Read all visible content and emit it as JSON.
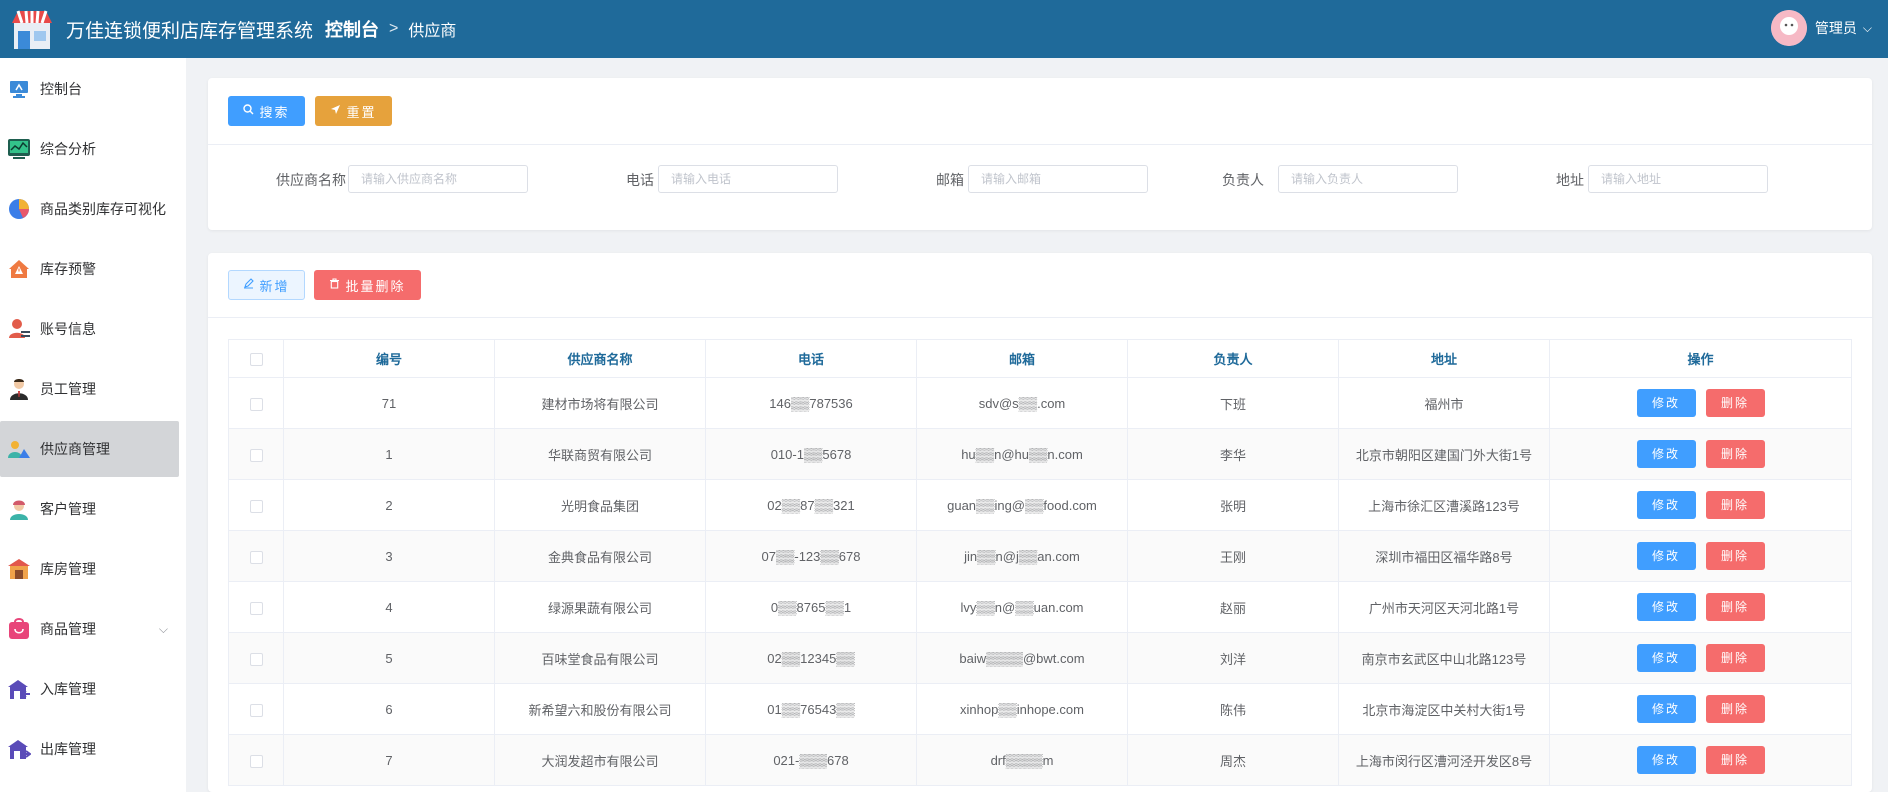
{
  "header": {
    "app_title": "万佳连锁便利店库存管理系统",
    "breadcrumb_home": "控制台",
    "breadcrumb_sep": ">",
    "breadcrumb_current": "供应商",
    "user_name": "管理员",
    "user_caret": "⌵"
  },
  "sidebar": {
    "items": [
      {
        "label": "控制台",
        "icon": "monitor-icon"
      },
      {
        "label": "综合分析",
        "icon": "analytics-icon"
      },
      {
        "label": "商品类别库存可视化",
        "icon": "pie-chart-icon"
      },
      {
        "label": "库存预警",
        "icon": "warning-icon"
      },
      {
        "label": "账号信息",
        "icon": "account-icon"
      },
      {
        "label": "员工管理",
        "icon": "employee-icon"
      },
      {
        "label": "供应商管理",
        "icon": "supplier-icon",
        "active": true
      },
      {
        "label": "客户管理",
        "icon": "customer-icon"
      },
      {
        "label": "库房管理",
        "icon": "warehouse-icon"
      },
      {
        "label": "商品管理",
        "icon": "goods-icon",
        "expandable": true
      },
      {
        "label": "入库管理",
        "icon": "stock-in-icon"
      },
      {
        "label": "出库管理",
        "icon": "stock-out-icon"
      }
    ]
  },
  "search_panel": {
    "search_button": "搜索",
    "reset_button": "重置",
    "fields": [
      {
        "label": "供应商名称",
        "placeholder": "请输入供应商名称"
      },
      {
        "label": "电话",
        "placeholder": "请输入电话"
      },
      {
        "label": "邮箱",
        "placeholder": "请输入邮箱"
      },
      {
        "label": "负责人",
        "placeholder": "请输入负责人"
      },
      {
        "label": "地址",
        "placeholder": "请输入地址"
      }
    ]
  },
  "table_panel": {
    "add_button": "新增",
    "batch_delete_button": "批量删除",
    "columns": [
      "编号",
      "供应商名称",
      "电话",
      "邮箱",
      "负责人",
      "地址",
      "操作"
    ],
    "edit_label": "修改",
    "delete_label": "删除",
    "rows": [
      {
        "id": "71",
        "name": "建材市场将有限公司",
        "phone": "146▒▒787536",
        "email": "sdv@s▒▒.com",
        "contact": "下班",
        "address": "福州市"
      },
      {
        "id": "1",
        "name": "华联商贸有限公司",
        "phone": "010-1▒▒5678",
        "email": "hu▒▒n@hu▒▒n.com",
        "contact": "李华",
        "address": "北京市朝阳区建国门外大街1号"
      },
      {
        "id": "2",
        "name": "光明食品集团",
        "phone": "02▒▒87▒▒321",
        "email": "guan▒▒ing@▒▒food.com",
        "contact": "张明",
        "address": "上海市徐汇区漕溪路123号"
      },
      {
        "id": "3",
        "name": "金典食品有限公司",
        "phone": "07▒▒-123▒▒678",
        "email": "jin▒▒n@j▒▒an.com",
        "contact": "王刚",
        "address": "深圳市福田区福华路8号"
      },
      {
        "id": "4",
        "name": "绿源果蔬有限公司",
        "phone": "0▒▒8765▒▒1",
        "email": "lvy▒▒n@▒▒uan.com",
        "contact": "赵丽",
        "address": "广州市天河区天河北路1号"
      },
      {
        "id": "5",
        "name": "百味堂食品有限公司",
        "phone": "02▒▒12345▒▒",
        "email": "baiw▒▒▒▒@bwt.com",
        "contact": "刘洋",
        "address": "南京市玄武区中山北路123号"
      },
      {
        "id": "6",
        "name": "新希望六和股份有限公司",
        "phone": "01▒▒76543▒▒",
        "email": "xinhop▒▒inhope.com",
        "contact": "陈伟",
        "address": "北京市海淀区中关村大街1号"
      },
      {
        "id": "7",
        "name": "大润发超市有限公司",
        "phone": "021-▒▒▒678",
        "email": "drf▒▒▒▒m",
        "contact": "周杰",
        "address": "上海市闵行区漕河泾开发区8号"
      }
    ]
  },
  "colors": {
    "header_bg": "#1f6a9a",
    "primary": "#409eff",
    "warning": "#e6a23c",
    "danger": "#f56c6c",
    "active_menu_bg": "#d3d5d8"
  }
}
